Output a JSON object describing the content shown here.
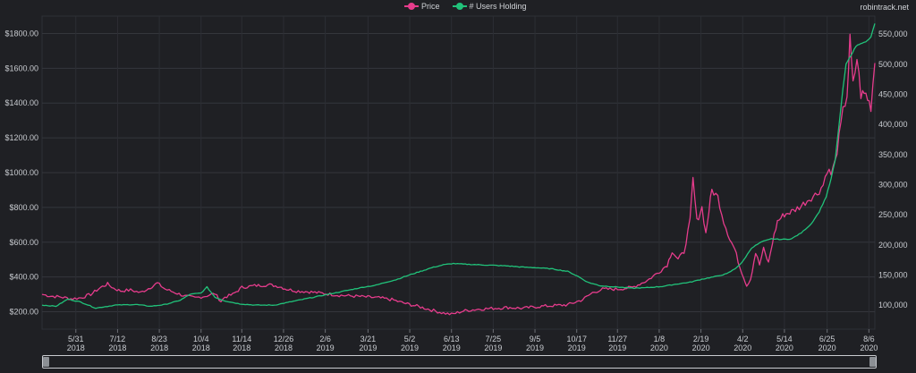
{
  "header": {
    "legend": [
      {
        "label": "Price",
        "color": "#e63c8c"
      },
      {
        "label": "# Users Holding",
        "color": "#21c27a"
      }
    ],
    "site": "robintrack.net"
  },
  "chart_data": {
    "type": "line",
    "x_ticks": [
      {
        "day": 0,
        "date": "5/31",
        "year": "2018"
      },
      {
        "day": 42,
        "date": "7/12",
        "year": "2018"
      },
      {
        "day": 84,
        "date": "8/23",
        "year": "2018"
      },
      {
        "day": 126,
        "date": "10/4",
        "year": "2018"
      },
      {
        "day": 167,
        "date": "11/14",
        "year": "2018"
      },
      {
        "day": 209,
        "date": "12/26",
        "year": "2018"
      },
      {
        "day": 251,
        "date": "2/6",
        "year": "2019"
      },
      {
        "day": 294,
        "date": "3/21",
        "year": "2019"
      },
      {
        "day": 336,
        "date": "5/2",
        "year": "2019"
      },
      {
        "day": 378,
        "date": "6/13",
        "year": "2019"
      },
      {
        "day": 420,
        "date": "7/25",
        "year": "2019"
      },
      {
        "day": 462,
        "date": "9/5",
        "year": "2019"
      },
      {
        "day": 504,
        "date": "10/17",
        "year": "2019"
      },
      {
        "day": 545,
        "date": "11/27",
        "year": "2019"
      },
      {
        "day": 587,
        "date": "1/8",
        "year": "2020"
      },
      {
        "day": 629,
        "date": "2/19",
        "year": "2020"
      },
      {
        "day": 671,
        "date": "4/2",
        "year": "2020"
      },
      {
        "day": 713,
        "date": "5/14",
        "year": "2020"
      },
      {
        "day": 756,
        "date": "6/25",
        "year": "2020"
      },
      {
        "day": 798,
        "date": "8/6",
        "year": "2020"
      }
    ],
    "x_range": [
      -34,
      804
    ],
    "y_left": {
      "min": 100,
      "max": 1900,
      "ticks": [
        200,
        400,
        600,
        800,
        1000,
        1200,
        1400,
        1600,
        1800
      ],
      "labels": [
        "$200.00",
        "$400.00",
        "$600.00",
        "$800.00",
        "$1000.00",
        "$1200.00",
        "$1400.00",
        "$1600.00",
        "$1800.00"
      ]
    },
    "y_right": {
      "min": 60000,
      "max": 580000,
      "ticks": [
        100000,
        150000,
        200000,
        250000,
        300000,
        350000,
        400000,
        450000,
        500000,
        550000
      ],
      "labels": [
        "100,000",
        "150,000",
        "200,000",
        "250,000",
        "300,000",
        "350,000",
        "400,000",
        "450,000",
        "500,000",
        "550,000"
      ]
    },
    "grid": true,
    "series": [
      {
        "name": "Price",
        "axis": "left",
        "color": "#e63c8c",
        "points": [
          [
            -34,
            300
          ],
          [
            -25,
            290
          ],
          [
            -15,
            285
          ],
          [
            -5,
            275
          ],
          [
            5,
            280
          ],
          [
            15,
            300
          ],
          [
            25,
            340
          ],
          [
            32,
            360
          ],
          [
            38,
            335
          ],
          [
            45,
            320
          ],
          [
            55,
            325
          ],
          [
            65,
            310
          ],
          [
            75,
            340
          ],
          [
            82,
            365
          ],
          [
            90,
            330
          ],
          [
            100,
            310
          ],
          [
            110,
            290
          ],
          [
            120,
            280
          ],
          [
            130,
            290
          ],
          [
            140,
            305
          ],
          [
            146,
            260
          ],
          [
            150,
            285
          ],
          [
            158,
            300
          ],
          [
            167,
            340
          ],
          [
            180,
            350
          ],
          [
            195,
            355
          ],
          [
            205,
            345
          ],
          [
            212,
            330
          ],
          [
            222,
            320
          ],
          [
            235,
            315
          ],
          [
            250,
            305
          ],
          [
            265,
            295
          ],
          [
            280,
            290
          ],
          [
            292,
            285
          ],
          [
            305,
            280
          ],
          [
            318,
            270
          ],
          [
            330,
            250
          ],
          [
            345,
            230
          ],
          [
            358,
            210
          ],
          [
            368,
            195
          ],
          [
            378,
            185
          ],
          [
            390,
            205
          ],
          [
            405,
            215
          ],
          [
            420,
            220
          ],
          [
            435,
            225
          ],
          [
            450,
            220
          ],
          [
            465,
            230
          ],
          [
            480,
            235
          ],
          [
            495,
            240
          ],
          [
            510,
            270
          ],
          [
            520,
            310
          ],
          [
            530,
            330
          ],
          [
            545,
            330
          ],
          [
            560,
            340
          ],
          [
            575,
            380
          ],
          [
            587,
            430
          ],
          [
            595,
            470
          ],
          [
            600,
            550
          ],
          [
            606,
            500
          ],
          [
            612,
            545
          ],
          [
            618,
            720
          ],
          [
            621,
            960
          ],
          [
            625,
            720
          ],
          [
            630,
            800
          ],
          [
            634,
            650
          ],
          [
            637,
            780
          ],
          [
            640,
            900
          ],
          [
            646,
            860
          ],
          [
            652,
            720
          ],
          [
            658,
            620
          ],
          [
            663,
            560
          ],
          [
            668,
            460
          ],
          [
            672,
            400
          ],
          [
            675,
            350
          ],
          [
            679,
            390
          ],
          [
            684,
            540
          ],
          [
            688,
            470
          ],
          [
            692,
            560
          ],
          [
            697,
            480
          ],
          [
            701,
            600
          ],
          [
            706,
            720
          ],
          [
            713,
            760
          ],
          [
            722,
            780
          ],
          [
            730,
            810
          ],
          [
            738,
            850
          ],
          [
            746,
            880
          ],
          [
            752,
            930
          ],
          [
            756,
            1020
          ],
          [
            760,
            990
          ],
          [
            764,
            1060
          ],
          [
            768,
            1200
          ],
          [
            772,
            1350
          ],
          [
            776,
            1450
          ],
          [
            779,
            1760
          ],
          [
            782,
            1500
          ],
          [
            786,
            1660
          ],
          [
            790,
            1450
          ],
          [
            795,
            1450
          ],
          [
            800,
            1380
          ],
          [
            804,
            1640
          ]
        ]
      },
      {
        "name": "# Users Holding",
        "axis": "right",
        "color": "#21c27a",
        "points": [
          [
            -34,
            100000
          ],
          [
            -20,
            98000
          ],
          [
            -8,
            110000
          ],
          [
            5,
            105000
          ],
          [
            20,
            95000
          ],
          [
            40,
            100000
          ],
          [
            60,
            101000
          ],
          [
            75,
            98000
          ],
          [
            90,
            101000
          ],
          [
            105,
            108000
          ],
          [
            115,
            118000
          ],
          [
            126,
            120000
          ],
          [
            132,
            130000
          ],
          [
            140,
            113000
          ],
          [
            150,
            107000
          ],
          [
            165,
            102000
          ],
          [
            180,
            100000
          ],
          [
            200,
            100000
          ],
          [
            215,
            105000
          ],
          [
            230,
            110000
          ],
          [
            245,
            115000
          ],
          [
            260,
            120000
          ],
          [
            275,
            125000
          ],
          [
            290,
            130000
          ],
          [
            302,
            133000
          ],
          [
            312,
            138000
          ],
          [
            322,
            142000
          ],
          [
            332,
            148000
          ],
          [
            345,
            155000
          ],
          [
            358,
            162000
          ],
          [
            370,
            167000
          ],
          [
            380,
            169000
          ],
          [
            390,
            168000
          ],
          [
            405,
            167000
          ],
          [
            420,
            166000
          ],
          [
            435,
            165000
          ],
          [
            450,
            163000
          ],
          [
            465,
            162000
          ],
          [
            480,
            160000
          ],
          [
            495,
            156000
          ],
          [
            505,
            148000
          ],
          [
            515,
            138000
          ],
          [
            528,
            132000
          ],
          [
            545,
            130000
          ],
          [
            560,
            128000
          ],
          [
            575,
            129000
          ],
          [
            590,
            131000
          ],
          [
            605,
            135000
          ],
          [
            618,
            138000
          ],
          [
            630,
            143000
          ],
          [
            645,
            148000
          ],
          [
            655,
            152000
          ],
          [
            663,
            160000
          ],
          [
            670,
            170000
          ],
          [
            680,
            195000
          ],
          [
            690,
            205000
          ],
          [
            700,
            210000
          ],
          [
            710,
            209000
          ],
          [
            720,
            210000
          ],
          [
            730,
            220000
          ],
          [
            740,
            235000
          ],
          [
            748,
            255000
          ],
          [
            755,
            280000
          ],
          [
            760,
            310000
          ],
          [
            764,
            340000
          ],
          [
            768,
            400000
          ],
          [
            772,
            460000
          ],
          [
            775,
            500000
          ],
          [
            780,
            515000
          ],
          [
            785,
            530000
          ],
          [
            790,
            535000
          ],
          [
            795,
            537000
          ],
          [
            800,
            545000
          ],
          [
            804,
            568000
          ]
        ]
      }
    ]
  }
}
